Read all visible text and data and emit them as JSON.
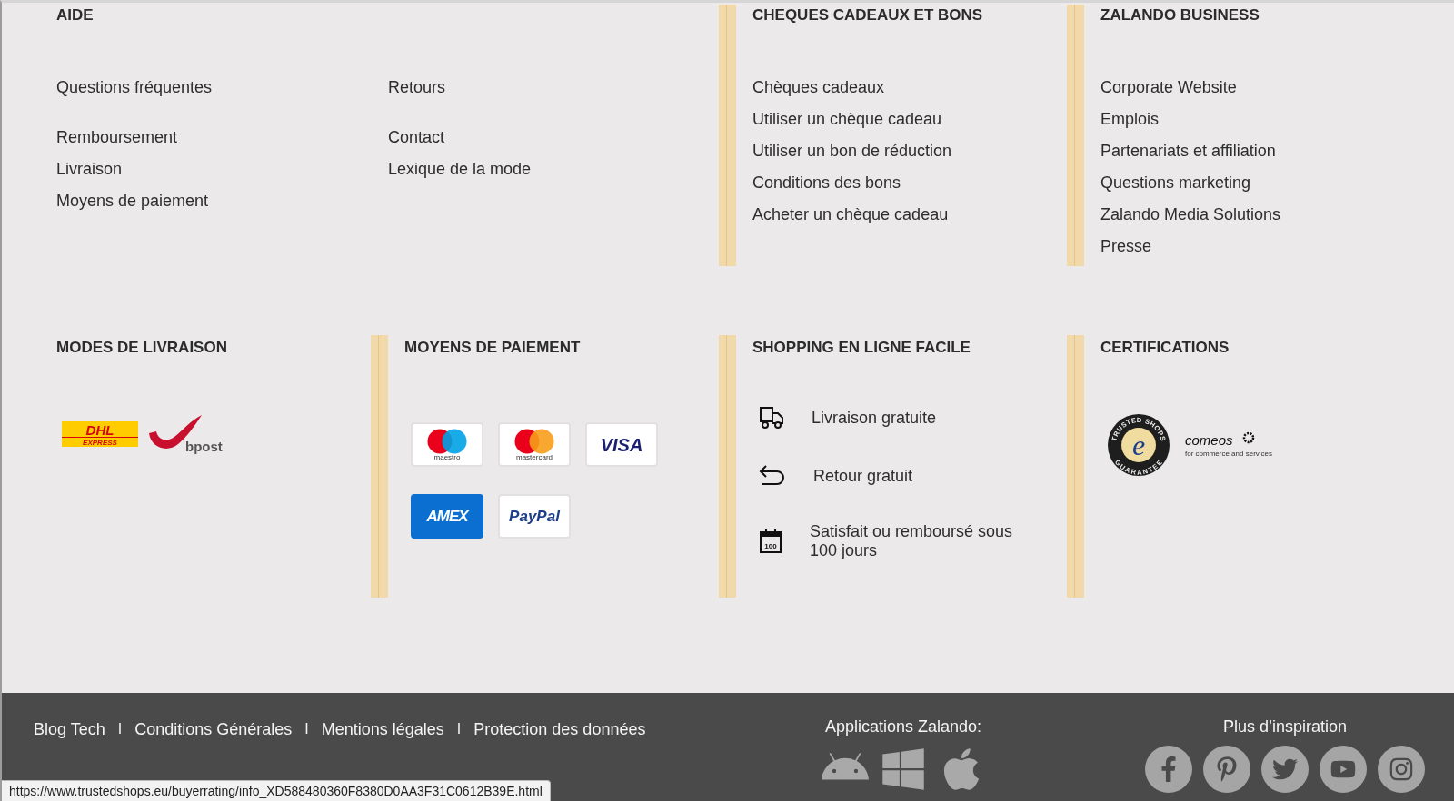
{
  "help": {
    "title": "AIDE",
    "columns": [
      {
        "groups": [
          [
            "Questions fréquentes"
          ],
          [
            "Remboursement",
            "Livraison",
            "Moyens de paiement"
          ]
        ]
      },
      {
        "groups": [
          [
            "Retours"
          ],
          [
            "Contact",
            "Lexique de la mode"
          ]
        ]
      }
    ]
  },
  "gift_cards": {
    "title": "CHEQUES CADEAUX ET BONS",
    "links": [
      "Chèques cadeaux",
      "Utiliser un chèque cadeau",
      "Utiliser un bon de réduction",
      "Conditions des bons",
      "Acheter un chèque cadeau"
    ]
  },
  "business": {
    "title": "ZALANDO BUSINESS",
    "links": [
      "Corporate Website",
      "Emplois",
      "Partenariats et affiliation",
      "Questions marketing",
      "Zalando Media Solutions",
      "Presse"
    ]
  },
  "delivery": {
    "title": "MODES DE LIVRAISON",
    "carriers": [
      {
        "kind": "dhl",
        "label": "DHL",
        "sublabel": "EXPRESS"
      },
      {
        "kind": "bpost",
        "label": "bpost"
      }
    ]
  },
  "payment": {
    "title": "MOYENS DE PAIEMENT",
    "methods": [
      {
        "kind": "maestro",
        "label": "maestro"
      },
      {
        "kind": "mastercard",
        "label": "mastercard"
      },
      {
        "kind": "visa",
        "label": "VISA"
      },
      {
        "kind": "amex",
        "label": "AMEX"
      },
      {
        "kind": "paypal",
        "label": "PayPal"
      }
    ]
  },
  "shopping": {
    "title": "SHOPPING EN LIGNE FACILE",
    "features": [
      {
        "kind": "truck",
        "text": "Livraison gratuite"
      },
      {
        "kind": "return",
        "text": "Retour gratuit"
      },
      {
        "kind": "calendar",
        "text": "Satisfait ou remboursé sous 100 jours",
        "badge": "100"
      }
    ]
  },
  "certifications": {
    "title": "CERTIFICATIONS",
    "seals": [
      {
        "kind": "trusted",
        "top": "TRUSTED SHOPS",
        "bottom": "GUARANTEE",
        "mark": "e"
      },
      {
        "kind": "comeos",
        "label": "comeos",
        "tagline": "for commerce and services"
      }
    ]
  },
  "footer": {
    "links": [
      {
        "kind": "link",
        "text": "Blog Tech"
      },
      {
        "kind": "separator",
        "text": "I"
      },
      {
        "kind": "link",
        "text": "Conditions Générales"
      },
      {
        "kind": "separator",
        "text": "I"
      },
      {
        "kind": "link",
        "text": "Mentions légales"
      },
      {
        "kind": "separator",
        "text": "I"
      },
      {
        "kind": "link",
        "text": "Protection des données"
      }
    ],
    "apps_title": "Applications Zalando:",
    "social_title": "Plus d’inspiration"
  },
  "status_bar": {
    "url": "https://www.trustedshops.eu/buyerrating/info_XD588480360F8380D0AA3F31C0612B39E.html"
  }
}
